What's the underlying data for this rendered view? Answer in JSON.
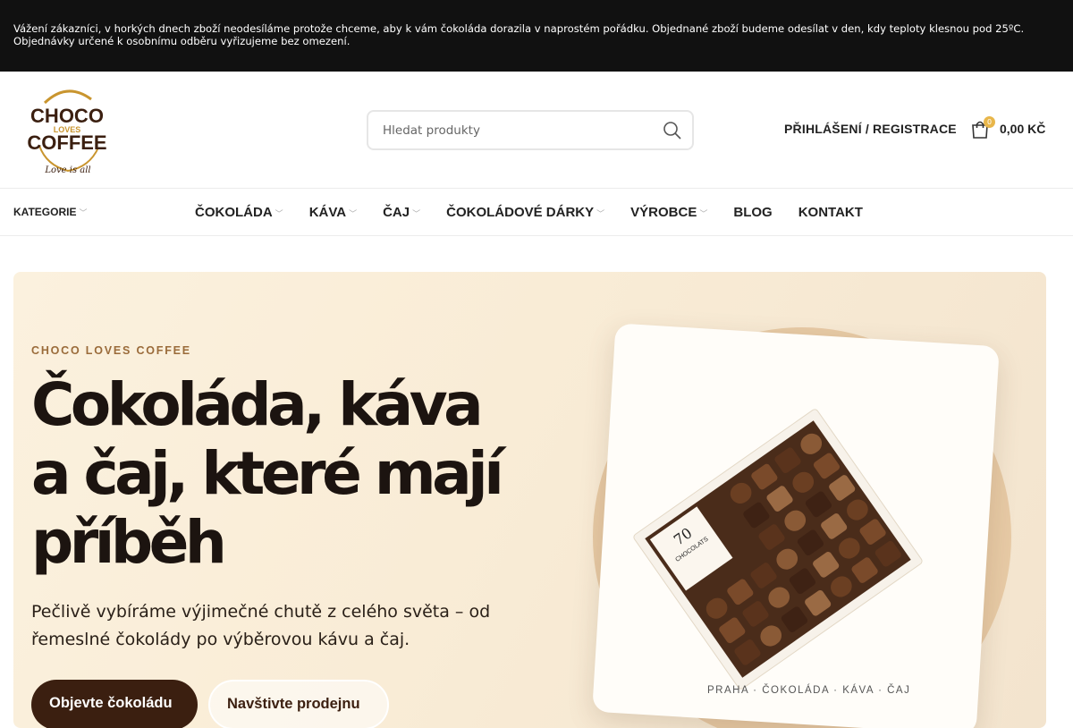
{
  "topbar": {
    "notice": "Vážení zákazníci, v horkých dnech zboží neodesíláme protože chceme, aby k vám čokoláda dorazila v naprostém pořádku. Objednané zboží budeme odesílat v den, kdy teploty klesnou pod 25ºC. Objednávky určené k osobnímu odběru vyřizujeme bez omezení."
  },
  "logo": {
    "line1": "CHOCO",
    "line2": "LOVES",
    "line3": "COFFEE",
    "tagline": "Love is all"
  },
  "search": {
    "placeholder": "Hledat produkty"
  },
  "account": {
    "label": "PŘIHLÁŠENÍ / REGISTRACE"
  },
  "cart": {
    "count": "0",
    "total": "0,00 KČ"
  },
  "nav": {
    "categories_label": "KATEGORIE",
    "items": [
      {
        "label": "ČOKOLÁDA"
      },
      {
        "label": "KÁVA"
      },
      {
        "label": "ČAJ"
      },
      {
        "label": "ČOKOLÁDOVÉ DÁRKY"
      },
      {
        "label": "VÝROBCE"
      },
      {
        "label": "BLOG"
      },
      {
        "label": "KONTAKT"
      }
    ]
  },
  "hero": {
    "eyebrow": "CHOCO LOVES COFFEE",
    "heading_line1": "Čokoláda, káva",
    "heading_line2": "a čaj, které mají",
    "heading_line3": "příběh",
    "lead": "Pečlivě vybíráme výjimečné chutě z celého světa – od řemeslné čokolády po výběrovou kávu a čaj.",
    "primary_button": "Objevte čokoládu",
    "secondary_button": "Navštivte prodejnu",
    "box_label_line1": "70",
    "box_label_line2": "CHOCOLATS",
    "caption": "PRAHA · ČOKOLÁDA · KÁVA · ČAJ"
  },
  "colors": {
    "topbar_bg": "#111111",
    "accent_gold": "#e8b64a",
    "brown_dark": "#3b1f10",
    "eyebrow": "#9a6b3a",
    "hero_bg": "#f9ecd6"
  }
}
